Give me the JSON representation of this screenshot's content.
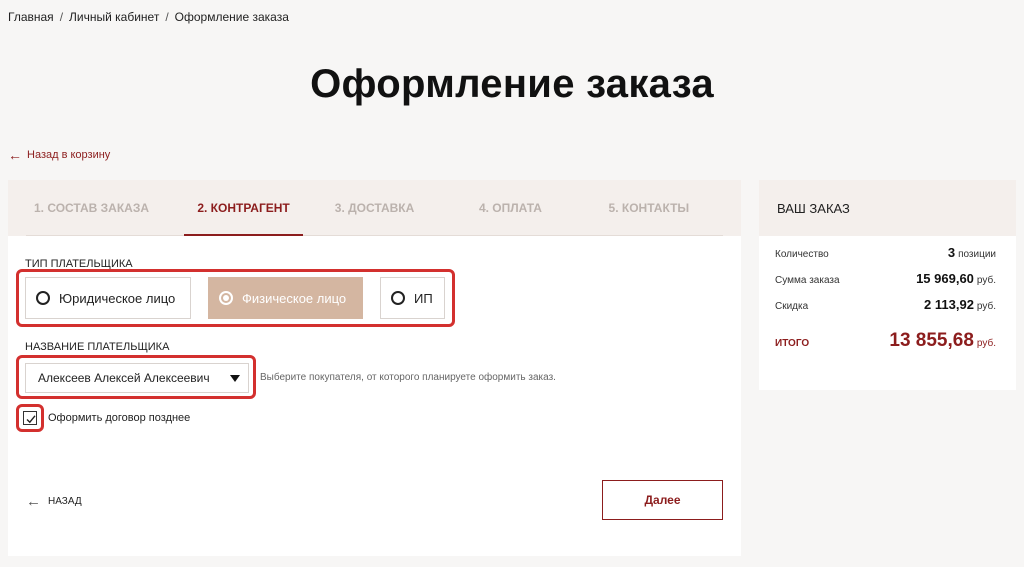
{
  "breadcrumb": [
    "Главная",
    "Личный кабинет",
    "Оформление заказа"
  ],
  "page_title": "Оформление заказа",
  "back_to_cart": "Назад в корзину",
  "steps": [
    {
      "label": "1. Состав заказа",
      "active": false
    },
    {
      "label": "2. Контрагент",
      "active": true
    },
    {
      "label": "3. Доставка",
      "active": false
    },
    {
      "label": "4. Оплата",
      "active": false
    },
    {
      "label": "5. Контакты",
      "active": false
    }
  ],
  "payer_type": {
    "label": "Тип плательщика",
    "options": [
      "Юридическое лицо",
      "Физическое лицо",
      "ИП"
    ],
    "selected": "Физическое лицо"
  },
  "payer_name": {
    "label": "Название плательщика",
    "value": "Алексеев Алексей Алексеевич",
    "hint": "Выберите покупателя, от которого планируете оформить заказ."
  },
  "contract_later": {
    "label": "Оформить договор позднее",
    "checked": true
  },
  "nav": {
    "back": "Назад",
    "next": "Далее"
  },
  "order": {
    "title": "Ваш заказ",
    "quantity_label": "Количество",
    "quantity_value": "3",
    "quantity_unit": "позиции",
    "sum_label": "Сумма заказа",
    "sum_value": "15 969,60",
    "sum_unit": "руб.",
    "discount_label": "Скидка",
    "discount_value": "2 113,92",
    "discount_unit": "руб.",
    "total_label": "Итого",
    "total_value": "13 855,68",
    "total_unit": "руб."
  },
  "colors": {
    "accent": "#8c1d1d",
    "selected": "#d4b6a1",
    "highlight": "#d3302e"
  }
}
